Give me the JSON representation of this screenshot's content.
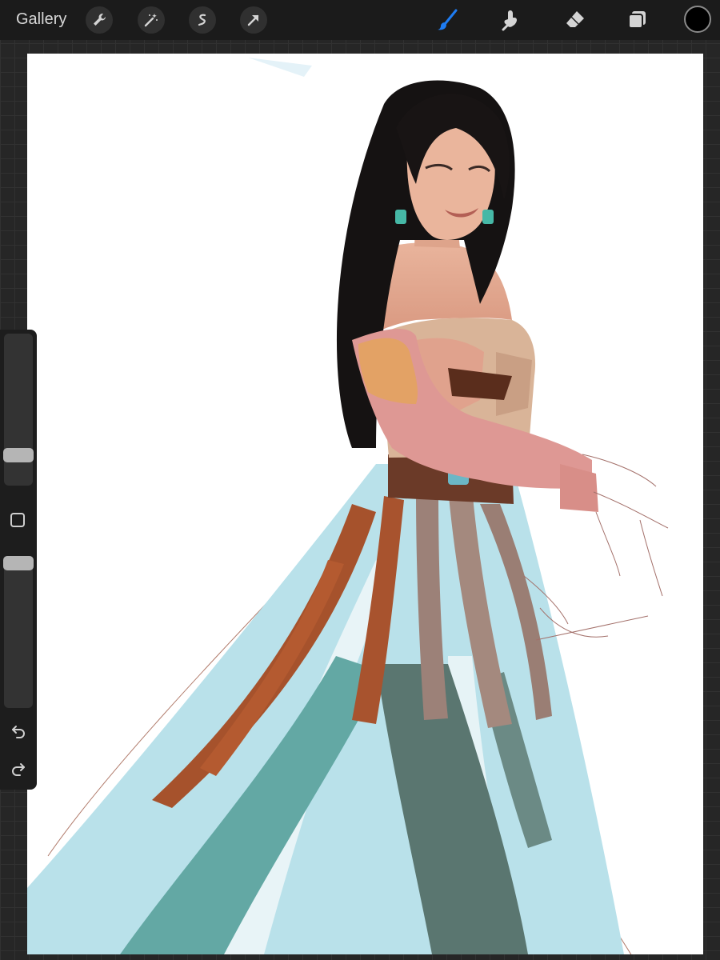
{
  "topbar": {
    "gallery_label": "Gallery",
    "left_tools": [
      "wrench-icon",
      "magic-wand-icon",
      "selection-icon",
      "transform-arrow-icon"
    ],
    "right_tools": [
      "brush-icon",
      "smudge-icon",
      "eraser-icon",
      "layers-icon"
    ],
    "active_tool": "brush",
    "active_color": "#000000",
    "accent_color": "#1e7cf2"
  },
  "sidebar": {
    "brush_size_level": 0.17,
    "opacity_level": 1.0,
    "undo_icon": "undo-icon",
    "redo_icon": "redo-icon"
  },
  "canvas": {
    "background": "#ffffff",
    "artwork": "illustration-wip"
  }
}
